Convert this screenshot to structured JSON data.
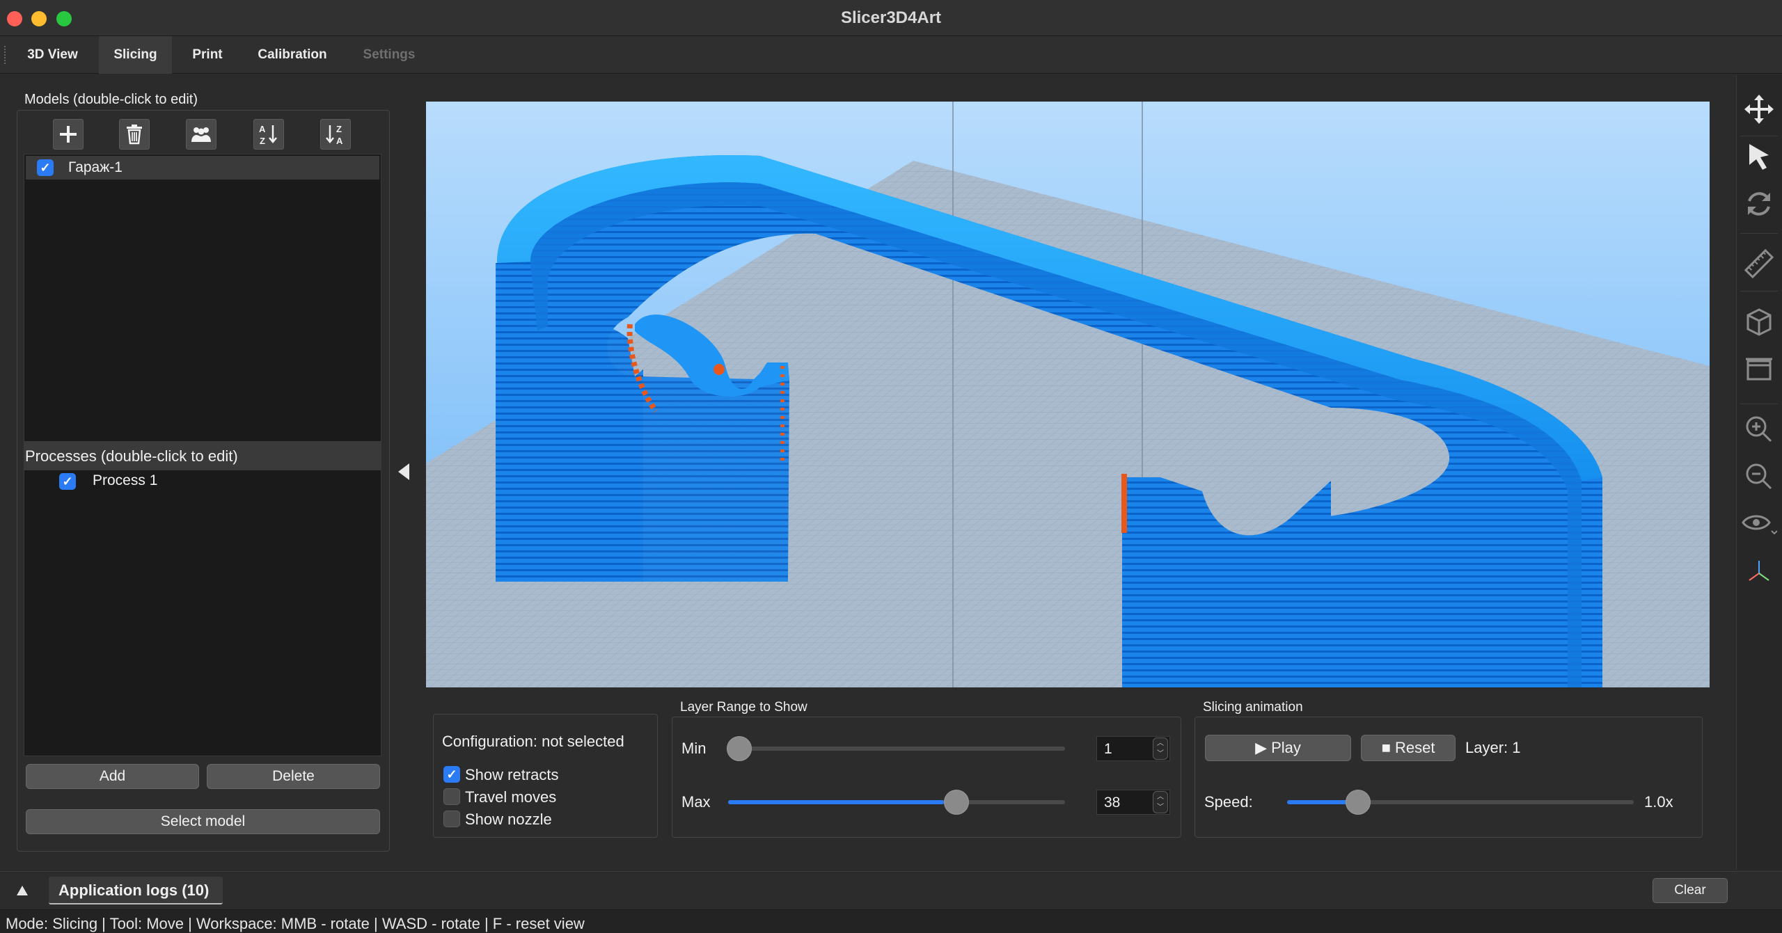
{
  "window": {
    "title": "Slicer3D4Art"
  },
  "tabs": [
    {
      "label": "3D View"
    },
    {
      "label": "Slicing"
    },
    {
      "label": "Print"
    },
    {
      "label": "Calibration"
    },
    {
      "label": "Settings"
    }
  ],
  "active_tab": "Slicing",
  "models": {
    "label": "Models (double-click to edit)",
    "toolbar_icons": [
      "add-icon",
      "trash-icon",
      "group-icon",
      "sort-az-icon",
      "sort-za-icon"
    ],
    "items": [
      {
        "name": "Гараж-1",
        "checked": true
      }
    ]
  },
  "processes": {
    "label": "Processes (double-click to edit)",
    "items": [
      {
        "name": "Process 1",
        "checked": true
      }
    ],
    "add_label": "Add",
    "delete_label": "Delete",
    "select_model_label": "Select model"
  },
  "config": {
    "status": "Configuration: not selected",
    "show_retracts": {
      "label": "Show retracts",
      "checked": true
    },
    "travel_moves": {
      "label": "Travel moves",
      "checked": false
    },
    "show_nozzle": {
      "label": "Show nozzle",
      "checked": false
    }
  },
  "layer_range": {
    "title": "Layer Range to Show",
    "min_label": "Min",
    "max_label": "Max",
    "min_value": "1",
    "max_value": "38",
    "min_fraction": 0.0,
    "max_fraction": 0.64
  },
  "animation": {
    "title": "Slicing animation",
    "play_label": "▶ Play",
    "reset_label": "■ Reset",
    "layer_text": "Layer: 1",
    "speed_label": "Speed:",
    "speed_value": "1.0x",
    "speed_fraction": 0.2
  },
  "right_tools": [
    "move-icon",
    "select-icon",
    "rotate-icon",
    "ruler-icon",
    "cube-icon",
    "box-icon",
    "zoom-in-icon",
    "zoom-out-icon",
    "eye-icon",
    "axes-icon"
  ],
  "logs": {
    "label": "Application logs (10)",
    "clear_label": "Clear"
  },
  "status": "Mode: Slicing | Tool: Move | Workspace: MMB - rotate | WASD - rotate | F - reset view",
  "colors": {
    "accent": "#2b7cf4",
    "model": "#1a8ef0",
    "retract": "#e8581c"
  }
}
